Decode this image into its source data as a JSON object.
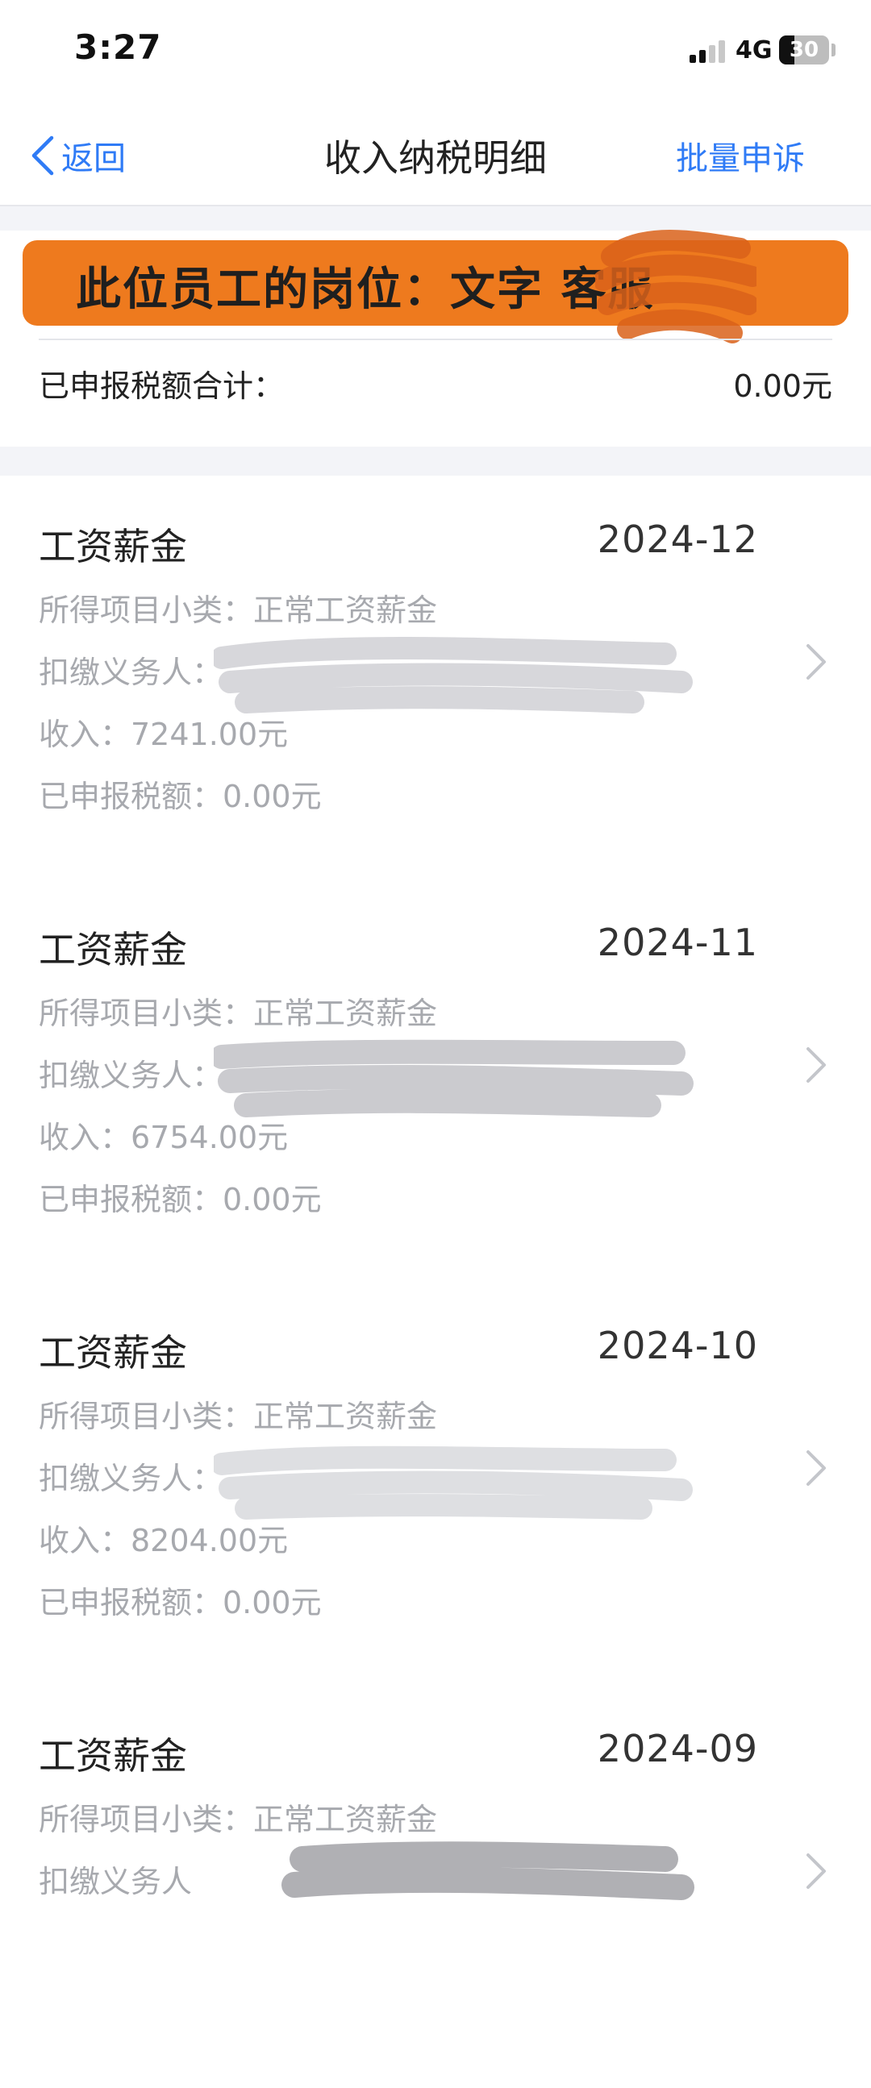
{
  "status_bar": {
    "time": "3:27",
    "network": "4G",
    "battery": "30"
  },
  "nav": {
    "back_label": "返回",
    "title": "收入纳税明细",
    "action_label": "批量申诉"
  },
  "summary": {
    "banner_text": "此位员工的岗位：文字  客服",
    "total_label": "已申报税额合计：",
    "total_value": "0.00元"
  },
  "records": [
    {
      "title": "工资薪金",
      "date": "2024-12",
      "subcategory": "所得项目小类：正常工资薪金",
      "withholder_label": "扣缴义务人：",
      "income": "收入：7241.00元",
      "tax": "已申报税额：0.00元"
    },
    {
      "title": "工资薪金",
      "date": "2024-11",
      "subcategory": "所得项目小类：正常工资薪金",
      "withholder_label": "扣缴义务人：",
      "income": "收入：6754.00元",
      "tax": "已申报税额：0.00元"
    },
    {
      "title": "工资薪金",
      "date": "2024-10",
      "subcategory": "所得项目小类：正常工资薪金",
      "withholder_label": "扣缴义务人：",
      "income": "收入：8204.00元",
      "tax": "已申报税额：0.00元"
    },
    {
      "title": "工资薪金",
      "date": "2024-09",
      "subcategory": "所得项目小类：正常工资薪金",
      "withholder_label": "扣缴义务人",
      "income": "",
      "tax": ""
    }
  ],
  "colors": {
    "link": "#2f7bf6",
    "banner": "#ee7a1e",
    "secondary_text": "#a7a9ae",
    "page_bg": "#f3f4f8"
  }
}
